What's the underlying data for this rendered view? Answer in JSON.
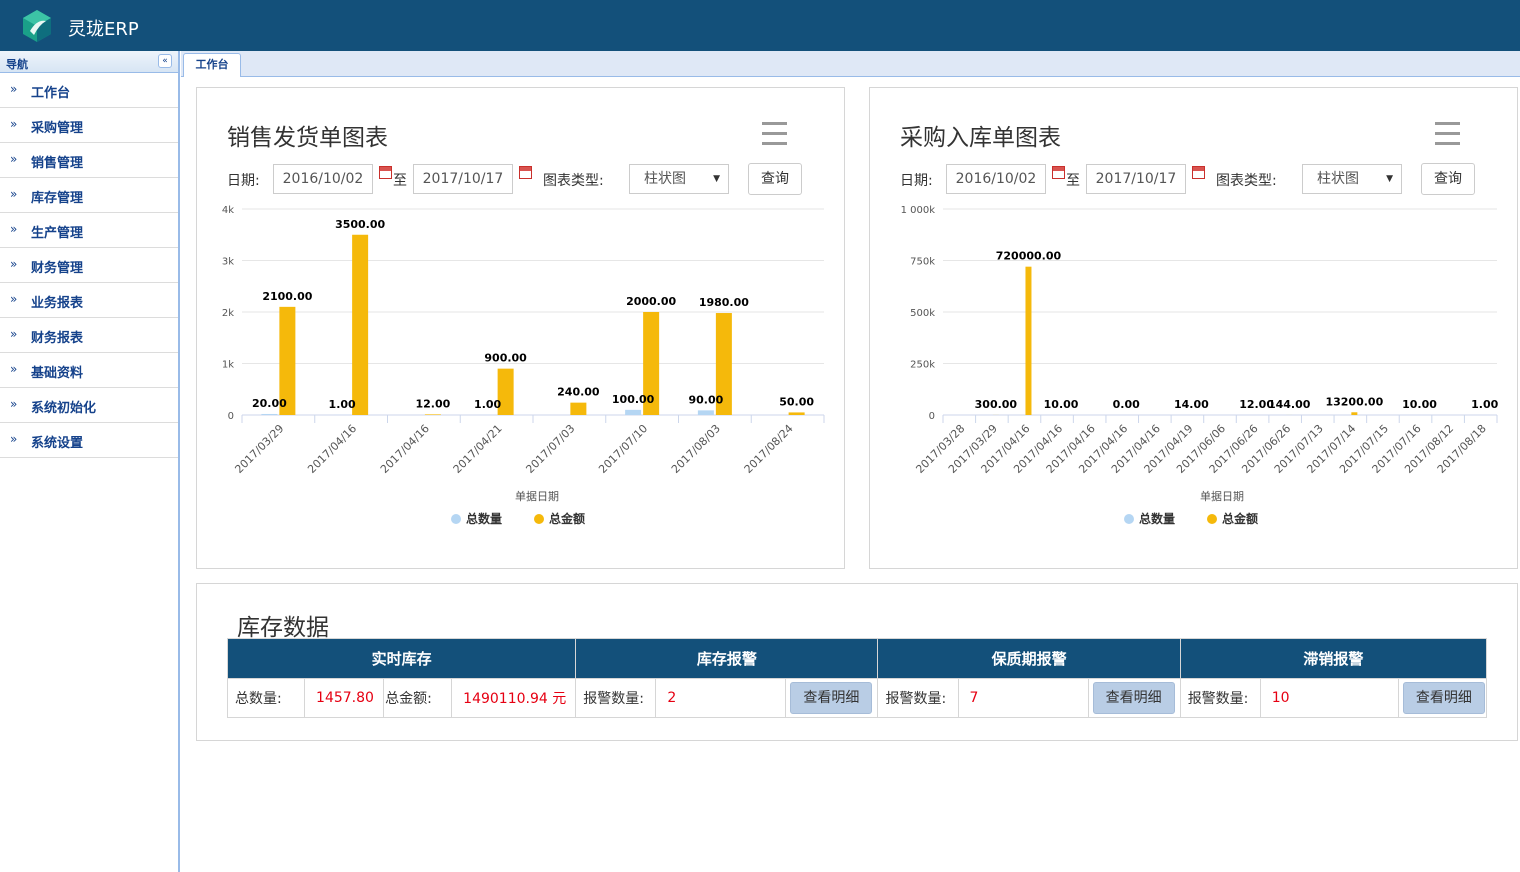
{
  "header": {
    "title": "灵珑ERP"
  },
  "sidebar": {
    "title": "导航",
    "collapse_glyph": "«",
    "items": [
      {
        "label": "工作台"
      },
      {
        "label": "采购管理"
      },
      {
        "label": "销售管理"
      },
      {
        "label": "库存管理"
      },
      {
        "label": "生产管理"
      },
      {
        "label": "财务管理"
      },
      {
        "label": "业务报表"
      },
      {
        "label": "财务报表"
      },
      {
        "label": "基础资料"
      },
      {
        "label": "系统初始化"
      },
      {
        "label": "系统设置"
      }
    ]
  },
  "tabs": [
    {
      "label": "工作台"
    }
  ],
  "sales_panel": {
    "title": "销售发货单图表",
    "date_label": "日期:",
    "start_date": "2016/10/02",
    "to_label": "至",
    "end_date": "2017/10/17",
    "chart_type_label": "图表类型:",
    "chart_type_value": "柱状图",
    "query_label": "查询"
  },
  "purchase_panel": {
    "title": "采购入库单图表",
    "date_label": "日期:",
    "start_date": "2016/10/02",
    "to_label": "至",
    "end_date": "2017/10/17",
    "chart_type_label": "图表类型:",
    "chart_type_value": "柱状图",
    "query_label": "查询"
  },
  "colors": {
    "quantity": "#b5d6f3",
    "amount": "#f5b90b",
    "header": "#13507a"
  },
  "chart_data": [
    {
      "type": "bar",
      "xlabel": "单据日期",
      "ylabel": "",
      "ylim": [
        0,
        4000
      ],
      "yticks": [
        "0",
        "1k",
        "2k",
        "3k",
        "4k"
      ],
      "categories": [
        "2017/03/29",
        "2017/04/16",
        "2017/04/16",
        "2017/04/21",
        "2017/07/03",
        "2017/07/10",
        "2017/08/03",
        "2017/08/24"
      ],
      "series": [
        {
          "name": "总数量",
          "values": [
            20,
            1,
            null,
            1,
            null,
            100,
            90,
            null
          ],
          "labels": [
            "20.00",
            "1.00",
            "",
            "1.00",
            "",
            "100.00",
            "90.00",
            ""
          ]
        },
        {
          "name": "总金额",
          "values": [
            2100,
            3500,
            12,
            900,
            240,
            2000,
            1980,
            50
          ],
          "labels": [
            "2100.00",
            "3500.00",
            "12.00",
            "900.00",
            "240.00",
            "2000.00",
            "1980.00",
            "50.00"
          ]
        }
      ],
      "legend": "bottom-center"
    },
    {
      "type": "bar",
      "xlabel": "单据日期",
      "ylabel": "",
      "ylim": [
        0,
        1000000
      ],
      "yticks": [
        "0",
        "250k",
        "500k",
        "750k",
        "1 000k"
      ],
      "categories": [
        "2017/03/28",
        "2017/03/29",
        "2017/04/16",
        "2017/04/16",
        "2017/04/16",
        "2017/04/16",
        "2017/04/16",
        "2017/04/19",
        "2017/06/06",
        "2017/06/26",
        "2017/06/26",
        "2017/07/13",
        "2017/07/14",
        "2017/07/15",
        "2017/07/16",
        "2017/08/12",
        "2017/08/18"
      ],
      "series": [
        {
          "name": "总数量",
          "values": [
            null,
            null,
            null,
            null,
            null,
            null,
            null,
            null,
            null,
            null,
            null,
            null,
            null,
            null,
            null,
            null,
            null
          ],
          "labels": [
            "",
            "",
            "",
            "",
            "",
            "",
            "",
            "",
            "",
            "",
            "",
            "",
            "",
            "",
            "",
            "",
            ""
          ]
        },
        {
          "name": "总金额",
          "values": [
            null,
            300,
            720000,
            10,
            null,
            0,
            null,
            14,
            null,
            12,
            144,
            null,
            13200,
            null,
            10,
            null,
            1
          ],
          "labels": [
            "",
            "300.00",
            "720000.00",
            "10.00",
            "",
            "0.00",
            "",
            "14.00",
            "",
            "12.00",
            "144.00",
            "",
            "13200.00",
            "",
            "10.00",
            "",
            "1.00"
          ]
        }
      ],
      "legend": "bottom-center"
    }
  ],
  "inventory": {
    "title": "库存数据",
    "headers": [
      "实时库存",
      "库存报警",
      "保质期报警",
      "滞销报警"
    ],
    "total_qty_label": "总数量:",
    "total_qty_value": "1457.80",
    "total_amount_label": "总金额:",
    "total_amount_value": "1490110.94 元",
    "stock_alarm_label": "报警数量:",
    "stock_alarm_value": "2",
    "expiry_alarm_label": "报警数量:",
    "expiry_alarm_value": "7",
    "slow_alarm_label": "报警数量:",
    "slow_alarm_value": "10",
    "detail_label": "查看明细"
  }
}
